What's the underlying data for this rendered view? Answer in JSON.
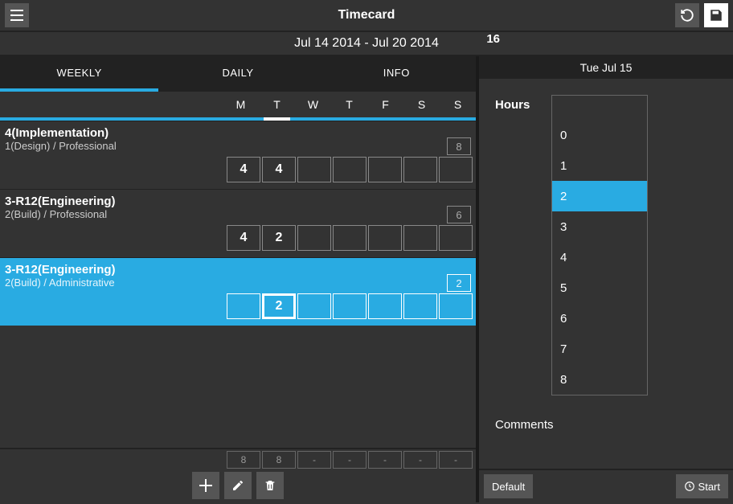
{
  "header": {
    "title": "Timecard"
  },
  "date_range": "Jul 14 2014 - Jul 20 2014",
  "total_hours": "16",
  "tabs": [
    "WEEKLY",
    "DAILY",
    "INFO"
  ],
  "active_tab": 0,
  "days": [
    "M",
    "T",
    "W",
    "T",
    "F",
    "S",
    "S"
  ],
  "selected_day_index": 1,
  "tasks": [
    {
      "title": "4(Implementation)",
      "sub": "1(Design) / Professional",
      "total": "8",
      "hours": [
        "4",
        "4",
        "",
        "",
        "",
        "",
        ""
      ],
      "selected": false
    },
    {
      "title": "3-R12(Engineering)",
      "sub": "2(Build) / Professional",
      "total": "6",
      "hours": [
        "4",
        "2",
        "",
        "",
        "",
        "",
        ""
      ],
      "selected": false
    },
    {
      "title": "3-R12(Engineering)",
      "sub": "2(Build) / Administrative",
      "total": "2",
      "hours": [
        "",
        "2",
        "",
        "",
        "",
        "",
        ""
      ],
      "selected": true,
      "active_cell": 1
    }
  ],
  "day_totals": [
    "8",
    "8",
    "-",
    "-",
    "-",
    "-",
    "-"
  ],
  "right": {
    "day_label": "Tue Jul 15",
    "hours_label": "Hours",
    "hour_options": [
      "0",
      "1",
      "2",
      "3",
      "4",
      "5",
      "6",
      "7",
      "8"
    ],
    "selected_hour": "2",
    "comments_label": "Comments",
    "default_btn": "Default",
    "start_btn": "Start"
  }
}
